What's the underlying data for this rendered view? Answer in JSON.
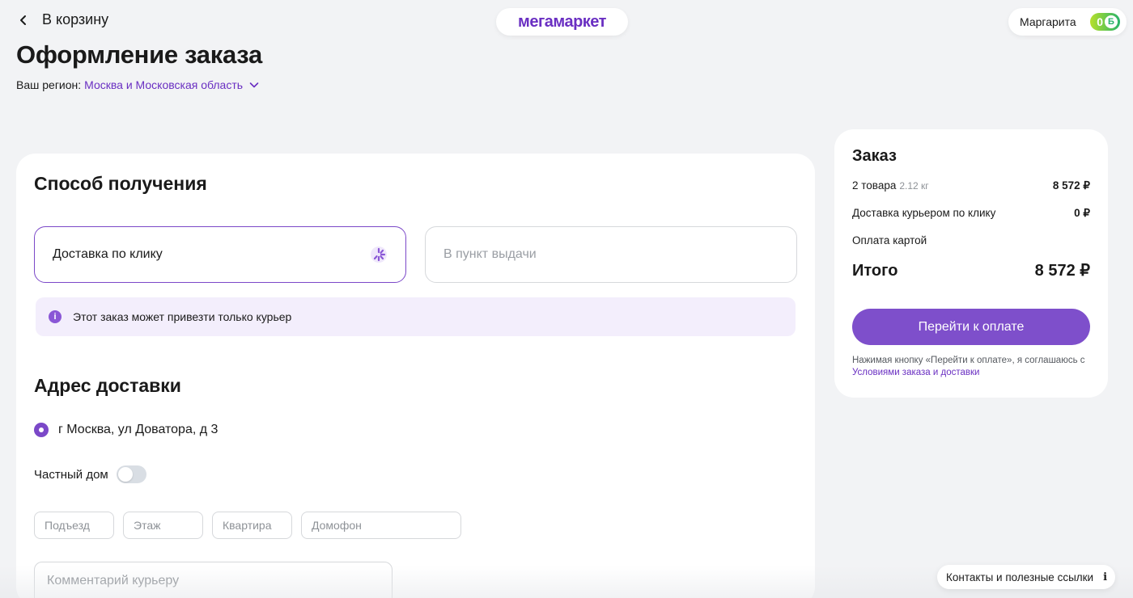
{
  "header": {
    "back_label": "В корзину",
    "logo": "мегамаркет",
    "user_name": "Маргарита",
    "bonus_count": "0",
    "bonus_symbol": "Б"
  },
  "page": {
    "title": "Оформление заказа",
    "region_label": "Ваш регион:",
    "region_value": "Москва и Московская область"
  },
  "delivery_method": {
    "title": "Способ получения",
    "options": [
      {
        "label": "Доставка по клику",
        "selected": true
      },
      {
        "label": "В пункт выдачи",
        "selected": false
      }
    ],
    "info_text": "Этот заказ может привезти только курьер"
  },
  "address": {
    "title": "Адрес доставки",
    "selected_address": "г Москва, ул Доватора, д 3",
    "private_house_label": "Частный дом",
    "private_house_on": false,
    "fields": {
      "entrance_placeholder": "Подъезд",
      "floor_placeholder": "Этаж",
      "apartment_placeholder": "Квартира",
      "intercom_placeholder": "Домофон"
    },
    "comment_placeholder": "Комментарий курьеру"
  },
  "summary": {
    "title": "Заказ",
    "items_label": "2 товара",
    "items_weight": "2.12 кг",
    "items_price": "8 572 ₽",
    "delivery_label": "Доставка курьером по клику",
    "delivery_price": "0 ₽",
    "payment_label": "Оплата картой",
    "total_label": "Итого",
    "total_value": "8 572 ₽",
    "pay_button": "Перейти к оплате",
    "terms_text": "Нажимая кнопку «Перейти к оплате», я соглашаюсь с",
    "terms_link": "Условиями заказа и доставки"
  },
  "footer": {
    "contacts_label": "Контакты и полезные ссылки"
  },
  "colors": {
    "accent": "#7e4fcb",
    "brand": "#6a2fc2",
    "info_bg": "#f3eefc",
    "background": "#f2f3f5"
  }
}
